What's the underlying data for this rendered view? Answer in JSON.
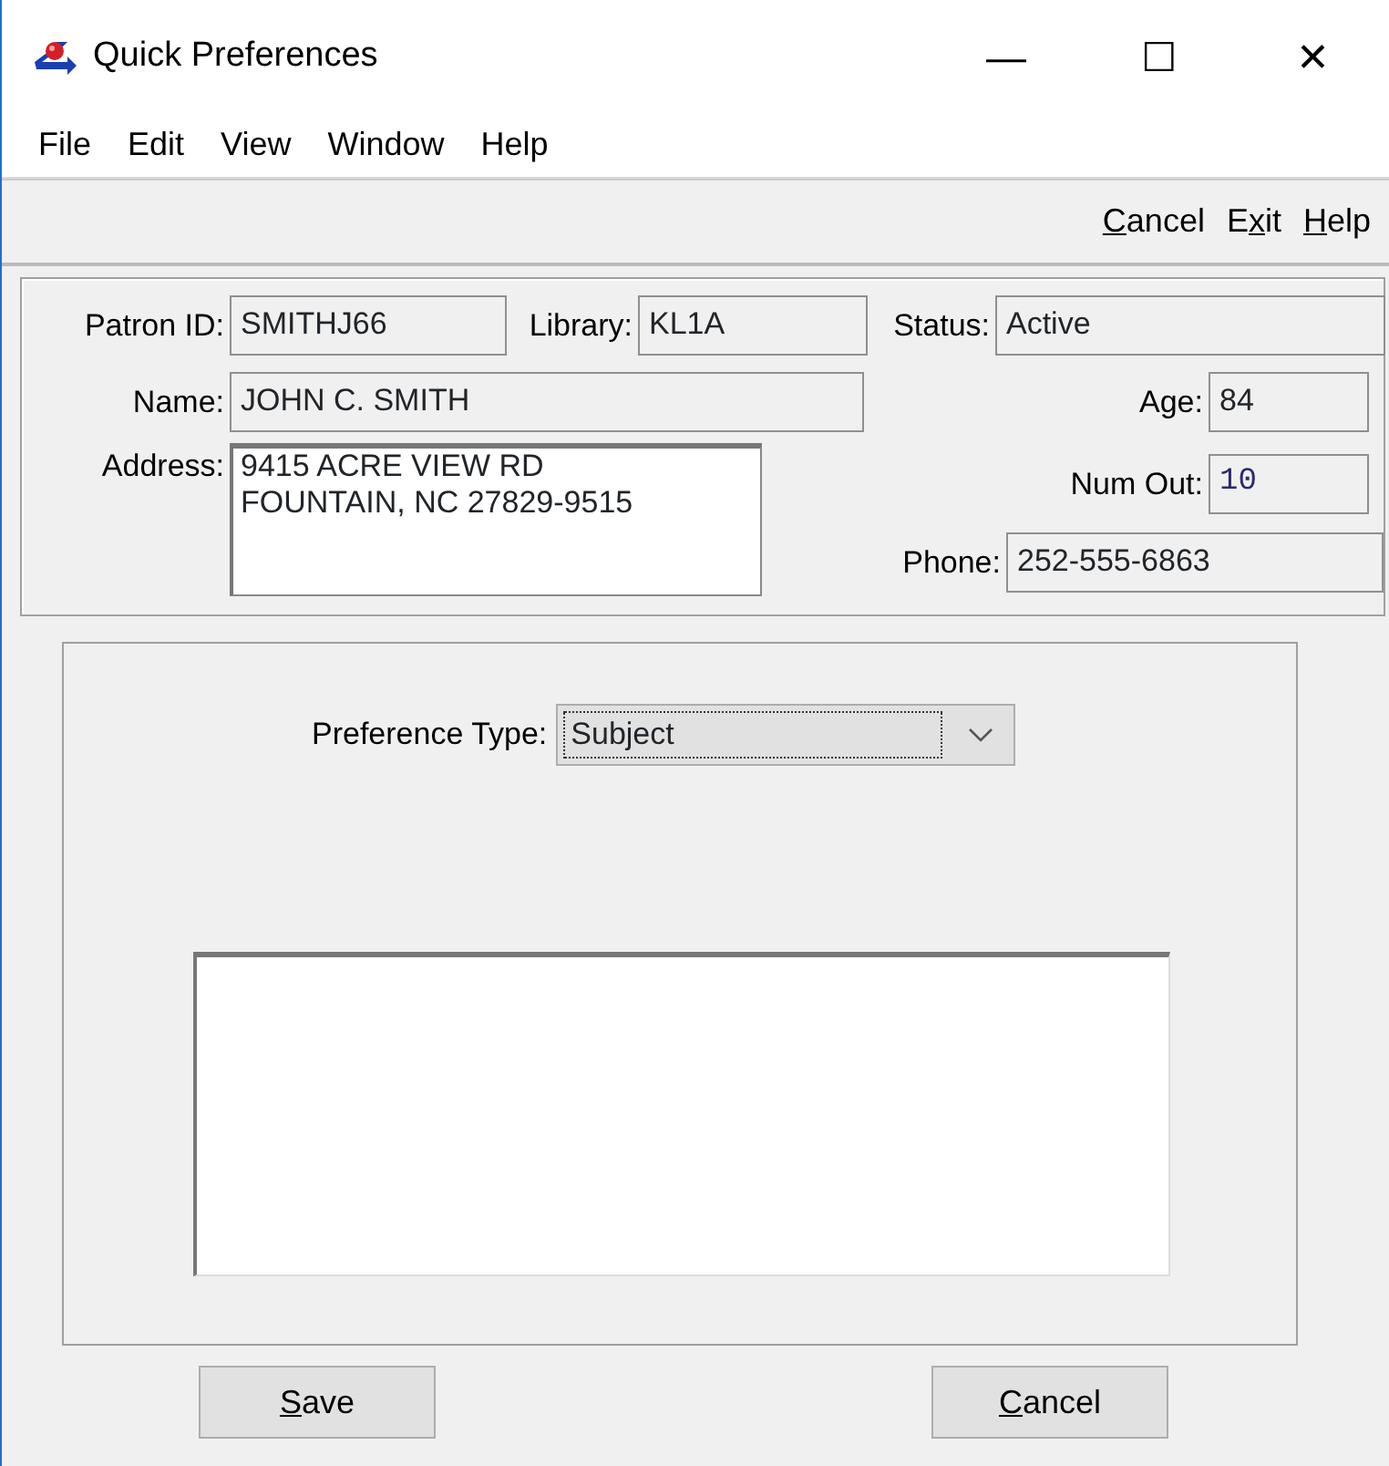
{
  "window": {
    "title": "Quick Preferences",
    "controls": [
      "—",
      "☐",
      "✕"
    ]
  },
  "menu": [
    "File",
    "Edit",
    "View",
    "Window",
    "Help"
  ],
  "toolbar": [
    {
      "key": "C",
      "post": "ancel"
    },
    {
      "pre": "E",
      "key": "x",
      "post": "it"
    },
    {
      "key": "H",
      "post": "elp"
    }
  ],
  "patron": {
    "patron_id": {
      "label": "Patron ID:",
      "value": "SMITHJ66"
    },
    "library": {
      "label": "Library:",
      "value": "KL1A"
    },
    "status": {
      "label": "Status:",
      "value": "Active"
    },
    "name": {
      "label": "Name:",
      "value": "JOHN C. SMITH"
    },
    "age": {
      "label": "Age:",
      "value": "84"
    },
    "address": {
      "label": "Address:",
      "lines": [
        "9415 ACRE VIEW RD",
        "FOUNTAIN, NC 27829-9515"
      ]
    },
    "num_out": {
      "label": "Num Out:",
      "value": "10"
    },
    "phone": {
      "label": "Phone:",
      "value": "252-555-6863"
    }
  },
  "preference_type": {
    "label": "Preference Type:",
    "value": "Subject",
    "focused": true
  },
  "buttons": [
    {
      "key": "S",
      "post": "ave"
    },
    {
      "key": "C",
      "post": "ancel"
    }
  ]
}
